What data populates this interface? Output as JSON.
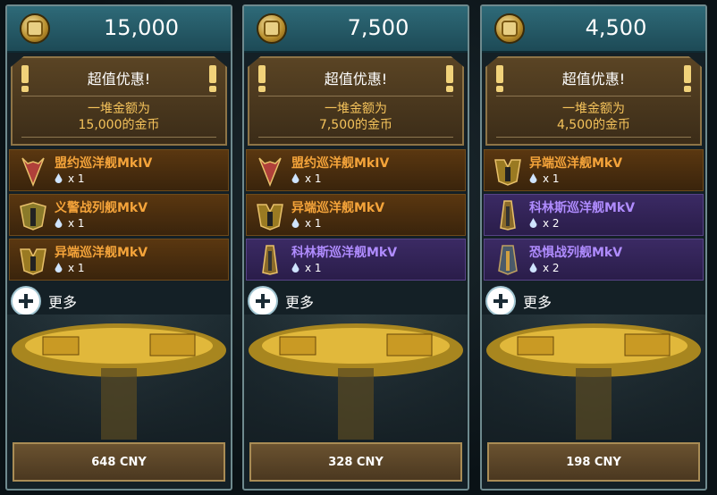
{
  "cards": [
    {
      "amount": "15,000",
      "deal_title": "超值优惠!",
      "deal_desc_line1": "一堆金额为",
      "deal_desc_line2": "15,000的金币",
      "items": [
        {
          "name": "盟约巡洋舰MkIV",
          "qty": "x 1",
          "rarity": "orange",
          "icon": "covenant-cruiser-icon"
        },
        {
          "name": "义警战列舰MkV",
          "qty": "x 1",
          "rarity": "orange",
          "icon": "vigilante-battleship-icon"
        },
        {
          "name": "异端巡洋舰MkV",
          "qty": "x 1",
          "rarity": "orange",
          "icon": "heretic-cruiser-icon"
        }
      ],
      "more_label": "更多",
      "price": "648 CNY"
    },
    {
      "amount": "7,500",
      "deal_title": "超值优惠!",
      "deal_desc_line1": "一堆金额为",
      "deal_desc_line2": "7,500的金币",
      "items": [
        {
          "name": "盟约巡洋舰MkIV",
          "qty": "x 1",
          "rarity": "orange",
          "icon": "covenant-cruiser-icon"
        },
        {
          "name": "异端巡洋舰MkV",
          "qty": "x 1",
          "rarity": "orange",
          "icon": "heretic-cruiser-icon"
        },
        {
          "name": "科林斯巡洋舰MkV",
          "qty": "x 1",
          "rarity": "purple",
          "icon": "corinth-cruiser-icon"
        }
      ],
      "more_label": "更多",
      "price": "328 CNY"
    },
    {
      "amount": "4,500",
      "deal_title": "超值优惠!",
      "deal_desc_line1": "一堆金额为",
      "deal_desc_line2": "4,500的金币",
      "items": [
        {
          "name": "异端巡洋舰MkV",
          "qty": "x 1",
          "rarity": "orange",
          "icon": "heretic-cruiser-icon"
        },
        {
          "name": "科林斯巡洋舰MkV",
          "qty": "x 2",
          "rarity": "purple",
          "icon": "corinth-cruiser-icon"
        },
        {
          "name": "恐惧战列舰MkV",
          "qty": "x 2",
          "rarity": "purple",
          "icon": "dread-battleship-icon"
        }
      ],
      "more_label": "更多",
      "price": "198 CNY"
    }
  ],
  "colors": {
    "orange_text": "#f5a43a",
    "purple_text": "#b08cff",
    "gold_text": "#f5c35b",
    "header": "#2e6a78"
  }
}
